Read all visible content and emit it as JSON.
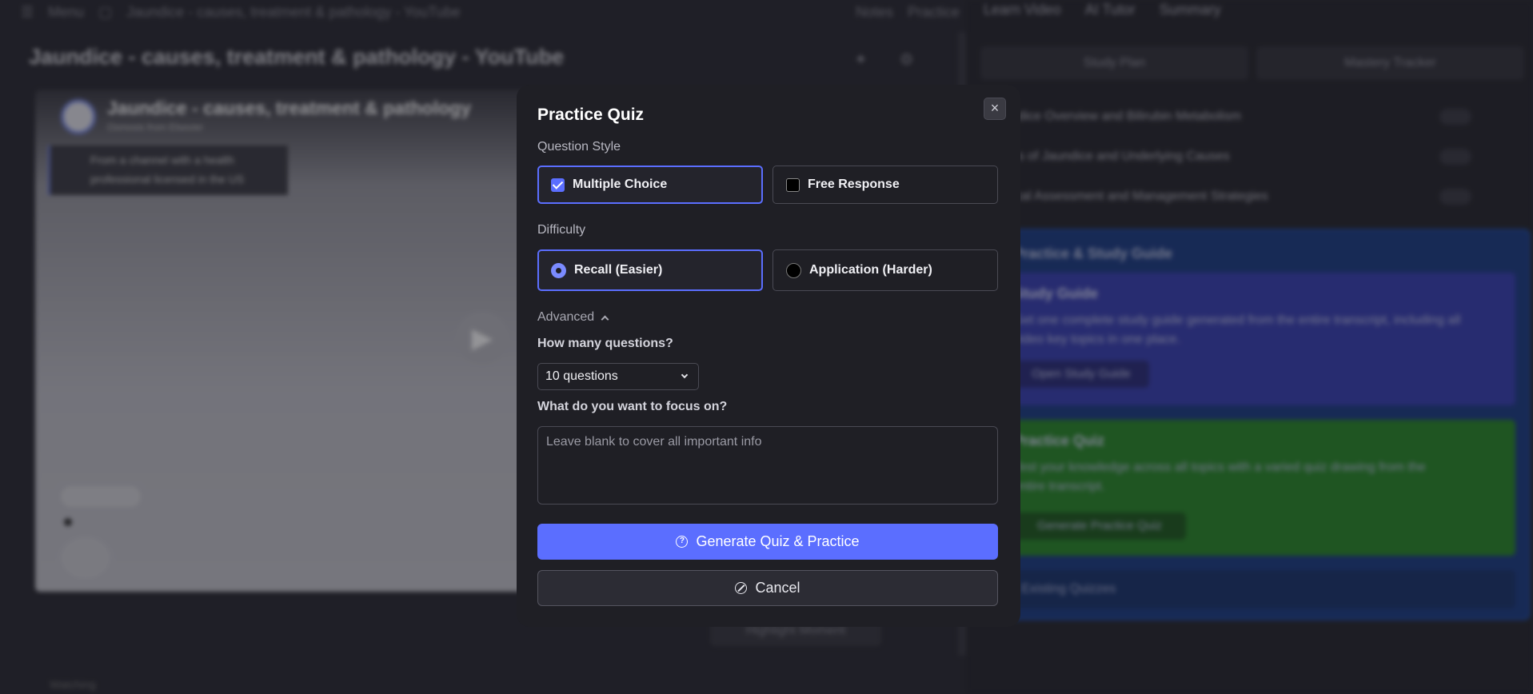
{
  "background": {
    "topbar": {
      "menu": "Menu",
      "tab_title": "Jaundice - causes, treatment & pathology - YouTube",
      "notes": "Notes",
      "practice": "Practice"
    },
    "page_title": "Jaundice - causes, treatment & pathology - YouTube",
    "video": {
      "title": "Jaundice - causes, treatment & pathology",
      "channel": "Osmosis from Elsevier",
      "info": "From a channel with a health professional licensed in the US"
    },
    "highlight_label": "Highlight Moment",
    "bottom_status": "Watching",
    "right_tabs": [
      "Learn Video",
      "AI Tutor",
      "Summary"
    ],
    "segments": [
      "Study Plan",
      "Mastery Tracker"
    ],
    "topics": [
      "Jaundice Overview and Bilirubin Metabolism",
      "Types of Jaundice and Underlying Causes",
      "Clinical Assessment and Management Strategies"
    ],
    "guide_header": "Practice & Study Guide",
    "study_card": {
      "title": "Study Guide",
      "desc": "Get one complete study guide generated from the entire transcript, including all video key topics in one place.",
      "button": "Open Study Guide"
    },
    "quiz_card": {
      "title": "Practice Quiz",
      "desc": "Test your knowledge across all topics with a varied quiz drawing from the entire transcript.",
      "button": "Generate Practice Quiz"
    },
    "existing": "Existing Quizzes"
  },
  "modal": {
    "title": "Practice Quiz",
    "close_symbol": "×",
    "question_style_label": "Question Style",
    "question_style_options": [
      {
        "label": "Multiple Choice",
        "selected": true
      },
      {
        "label": "Free Response",
        "selected": false
      }
    ],
    "difficulty_label": "Difficulty",
    "difficulty_options": [
      {
        "label": "Recall (Easier)",
        "selected": true
      },
      {
        "label": "Application (Harder)",
        "selected": false
      }
    ],
    "advanced_label": "Advanced",
    "count_label": "How many questions?",
    "count_value": "10 questions",
    "focus_label": "What do you want to focus on?",
    "focus_placeholder": "Leave blank to cover all important info",
    "generate_label": "Generate Quiz & Practice",
    "cancel_label": "Cancel"
  },
  "colors": {
    "accent": "#5b6eff",
    "modal_bg": "#1f1f25",
    "page_bg": "#2b2b33"
  }
}
